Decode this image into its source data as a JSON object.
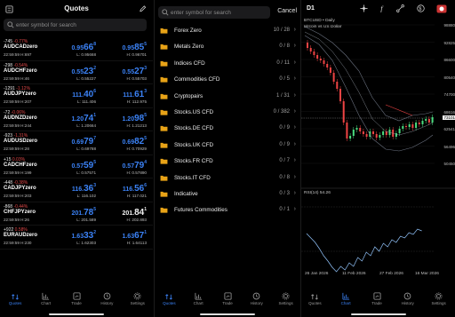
{
  "quotes_panel": {
    "title": "Quotes",
    "search_placeholder": "enter symbol for search",
    "rows": [
      {
        "change": "-745",
        "pct": "-0.77%",
        "symbol": "AUDCADzero",
        "time": "22:59:59",
        "spread": "H:697",
        "bid_pre": "0.95",
        "bid_big": "66",
        "bid_sup": "8",
        "ask_pre": "0.95",
        "ask_big": "85",
        "ask_sup": "5",
        "low": "L: 0.95668",
        "high": "H: 0.96701",
        "bid_color": "blue",
        "ask_color": "blue"
      },
      {
        "change": "-298",
        "pct": "-0.54%",
        "symbol": "AUDCHFzero",
        "time": "22:59:59",
        "spread": "H:46",
        "bid_pre": "0.55",
        "bid_big": "23",
        "bid_sup": "2",
        "ask_pre": "0.55",
        "ask_big": "27",
        "ask_sup": "3",
        "low": "L: 0.55227",
        "high": "H: 0.55703",
        "bid_color": "blue",
        "ask_color": "blue"
      },
      {
        "change": "-1291",
        "pct": "-1.12%",
        "symbol": "AUDJPYzero",
        "time": "22:59:59",
        "spread": "H:207",
        "bid_pre": "111.",
        "bid_big": "40",
        "bid_sup": "6",
        "ask_pre": "111.",
        "ask_big": "61",
        "ask_sup": "3",
        "low": "L: 111.406",
        "high": "H: 112.975",
        "bid_color": "blue",
        "ask_color": "blue"
      },
      {
        "change": "-72",
        "pct": "-0.06%",
        "symbol": "AUDNZDzero",
        "time": "22:59:59",
        "spread": "H:244",
        "bid_pre": "1.20",
        "bid_big": "74",
        "bid_sup": "1",
        "ask_pre": "1.20",
        "ask_big": "98",
        "ask_sup": "5",
        "low": "L: 1.20664",
        "high": "H: 1.21213",
        "bid_color": "blue",
        "ask_color": "blue"
      },
      {
        "change": "-923",
        "pct": "-1.31%",
        "symbol": "AUDUSDzero",
        "time": "22:59:59",
        "spread": "H:28",
        "bid_pre": "0.69",
        "bid_big": "79",
        "bid_sup": "7",
        "ask_pre": "0.69",
        "ask_big": "82",
        "ask_sup": "5",
        "low": "L: 0.69788",
        "high": "H: 0.70929",
        "bid_color": "blue",
        "ask_color": "blue"
      },
      {
        "change": "+15",
        "pct": "0.03%",
        "symbol": "CADCHFzero",
        "time": "22:59:59",
        "spread": "H:199",
        "bid_pre": "0.57",
        "bid_big": "59",
        "bid_sup": "5",
        "ask_pre": "0.57",
        "ask_big": "79",
        "ask_sup": "4",
        "low": "L: 0.57571",
        "high": "H: 0.57890",
        "bid_color": "blue",
        "ask_color": "blue"
      },
      {
        "change": "-448",
        "pct": "-0.38%",
        "symbol": "CADJPYzero",
        "time": "22:59:59",
        "spread": "H:203",
        "bid_pre": "116.",
        "bid_big": "36",
        "bid_sup": "3",
        "ask_pre": "116.",
        "ask_big": "56",
        "ask_sup": "6",
        "low": "L: 116.102",
        "high": "H: 117.021",
        "bid_color": "blue",
        "ask_color": "blue"
      },
      {
        "change": "-868",
        "pct": "-0.44%",
        "symbol": "CHFJPYzero",
        "time": "22:59:59",
        "spread": "H:26",
        "bid_pre": "201.",
        "bid_big": "78",
        "bid_sup": "5",
        "ask_pre": "201.",
        "ask_big": "84",
        "ask_sup": "1",
        "low": "L: 201.589",
        "high": "H: 202.893",
        "bid_color": "blue",
        "ask_color": "white"
      },
      {
        "change": "+922",
        "pct": "0.58%",
        "symbol": "EURAUDzero",
        "time": "22:59:59",
        "spread": "H:230",
        "bid_pre": "1.63",
        "bid_big": "33",
        "bid_sup": "2",
        "ask_pre": "1.63",
        "ask_big": "67",
        "ask_sup": "1",
        "low": "L: 1.62303",
        "high": "H: 1.64113",
        "bid_color": "blue",
        "ask_color": "blue"
      }
    ]
  },
  "groups_panel": {
    "search_placeholder": "enter symbol for search",
    "cancel_label": "Cancel",
    "groups": [
      {
        "name": "Forex Zero",
        "count": "10 / 28"
      },
      {
        "name": "Metals Zero",
        "count": "0 / 8"
      },
      {
        "name": "Indices CFD",
        "count": "0 / 11"
      },
      {
        "name": "Commodities CFD",
        "count": "0 / 5"
      },
      {
        "name": "Cryptopairs",
        "count": "1 / 31"
      },
      {
        "name": "Stocks.US CFD",
        "count": "0 / 382"
      },
      {
        "name": "Stocks.DE CFD",
        "count": "0 / 9"
      },
      {
        "name": "Stocks.UK CFD",
        "count": "0 / 9"
      },
      {
        "name": "Stocks.FR CFD",
        "count": "0 / 7"
      },
      {
        "name": "Stocks.IT CFD",
        "count": "0 / 8"
      },
      {
        "name": "Indicative",
        "count": "0 / 3"
      },
      {
        "name": "Futures Commodities",
        "count": "0 / 1"
      }
    ]
  },
  "chart_panel": {
    "timeframe": "D1",
    "symbol_line": "BTCUSD • Daily",
    "description": "Bitcoin vs US Dollar",
    "rsi_label": "RSI(14) 54.26",
    "price_ticks": [
      "98880",
      "92825",
      "86600",
      "80540",
      "74700",
      "68616",
      "62541",
      "56496",
      "50450"
    ],
    "current_price": "73101",
    "date_labels": [
      "26 Jan 2026",
      "11 Feb 2026",
      "27 Feb 2026",
      "16 Mar 2026"
    ]
  },
  "chart_data": {
    "type": "line",
    "title": "BTCUSD • Daily",
    "subtitle": "Bitcoin vs US Dollar",
    "xlabel": "",
    "ylabel": "",
    "x": [
      "26 Jan 2026",
      "11 Feb 2026",
      "27 Feb 2026",
      "16 Mar 2026"
    ],
    "series": [
      {
        "name": "BTCUSD",
        "values": [
          93000,
          68000,
          66000,
          73101
        ]
      }
    ],
    "ylim": [
      50450,
      98880
    ]
  },
  "tabs": [
    {
      "label": "Quotes",
      "icon": "quotes-icon"
    },
    {
      "label": "Chart",
      "icon": "chart-icon"
    },
    {
      "label": "Trade",
      "icon": "trade-icon"
    },
    {
      "label": "History",
      "icon": "history-icon"
    },
    {
      "label": "Settings",
      "icon": "settings-icon"
    }
  ],
  "colors": {
    "accent": "#3b82f6",
    "down": "#ef4444",
    "up": "#3b82f6",
    "background": "#000000"
  }
}
